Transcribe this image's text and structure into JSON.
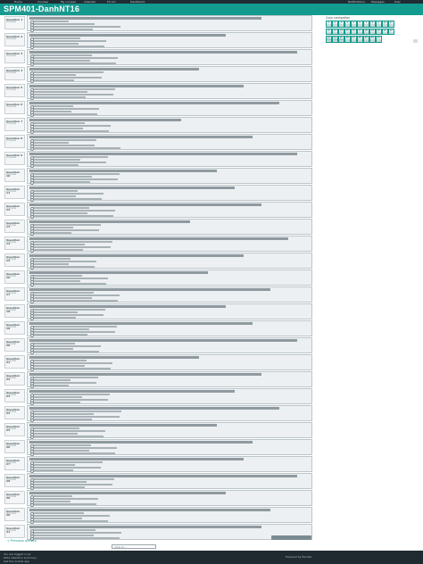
{
  "top_menu": [
    "Home",
    "Courses",
    "My courses",
    "Calendar",
    "Forum",
    "Dashboard"
  ],
  "top_right": [
    "Notifications",
    "Messages",
    "User"
  ],
  "header": {
    "title": "SPM401-DanhNT16"
  },
  "breadcrumb": "Home  /  Courses  /  SPM401  /  Quiz  /  Review",
  "questions": [
    {
      "n": "1"
    },
    {
      "n": "2"
    },
    {
      "n": "3"
    },
    {
      "n": "4"
    },
    {
      "n": "5"
    },
    {
      "n": "6"
    },
    {
      "n": "7"
    },
    {
      "n": "8"
    },
    {
      "n": "9"
    },
    {
      "n": "10"
    },
    {
      "n": "11"
    },
    {
      "n": "12"
    },
    {
      "n": "13"
    },
    {
      "n": "14"
    },
    {
      "n": "15"
    },
    {
      "n": "16"
    },
    {
      "n": "17"
    },
    {
      "n": "18"
    },
    {
      "n": "19"
    },
    {
      "n": "20"
    },
    {
      "n": "21"
    },
    {
      "n": "22"
    },
    {
      "n": "23"
    },
    {
      "n": "24"
    },
    {
      "n": "25"
    },
    {
      "n": "26"
    },
    {
      "n": "27"
    },
    {
      "n": "28"
    },
    {
      "n": "29"
    },
    {
      "n": "30"
    },
    {
      "n": "31"
    }
  ],
  "question_labels": {
    "prefix": "Question",
    "status": "Complete"
  },
  "nav_panel": {
    "title": "Quiz navigation",
    "finish_label": "Finish review",
    "cells": [
      "1",
      "2",
      "3",
      "4",
      "5",
      "6",
      "7",
      "8",
      "9",
      "10",
      "11",
      "12",
      "13",
      "14",
      "15",
      "16",
      "17",
      "18",
      "19",
      "20",
      "21",
      "22",
      "23",
      "24",
      "25",
      "26",
      "27",
      "28",
      "29",
      "30",
      "31"
    ]
  },
  "footer": {
    "prev_link": "< Previous activity",
    "jump_label": "Jump to...",
    "line1": "You are logged in as",
    "line2": "Data retention summary",
    "line3": "Get the mobile app",
    "right": "Powered by Moodle"
  },
  "colors": {
    "accent": "#139b8f",
    "topbar": "#202c33",
    "footer": "#1f2b31"
  }
}
